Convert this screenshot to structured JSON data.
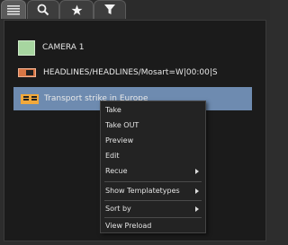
{
  "tabs": [
    {
      "icon": "list-icon",
      "active": true
    },
    {
      "icon": "search-icon",
      "active": false
    },
    {
      "icon": "star-icon",
      "active": false
    },
    {
      "icon": "filter-icon",
      "active": false
    }
  ],
  "list": {
    "items": [
      {
        "label": "CAMERA 1",
        "icon": "camera-icon",
        "selected": false
      },
      {
        "label": "HEADLINES/HEADLINES/Mosart=W|00:00|S",
        "icon": "headline-icon",
        "selected": false
      },
      {
        "label": "Transport strike in Europe",
        "icon": "story-icon",
        "selected": true
      }
    ]
  },
  "context_menu": {
    "items": [
      {
        "label": "Take",
        "submenu": false
      },
      {
        "label": "Take OUT",
        "submenu": false
      },
      {
        "label": "Preview",
        "submenu": false
      },
      {
        "label": "Edit",
        "submenu": false
      },
      {
        "label": "Recue",
        "submenu": true
      },
      {
        "label": "Show Templatetypes",
        "submenu": true
      },
      {
        "label": "Sort by",
        "submenu": true
      },
      {
        "label": "View Preload",
        "submenu": false
      }
    ]
  },
  "colors": {
    "selection": "#6e8bb0",
    "camera": "#a7d6a0",
    "headline": "#d87645",
    "story": "#f2a93b"
  }
}
